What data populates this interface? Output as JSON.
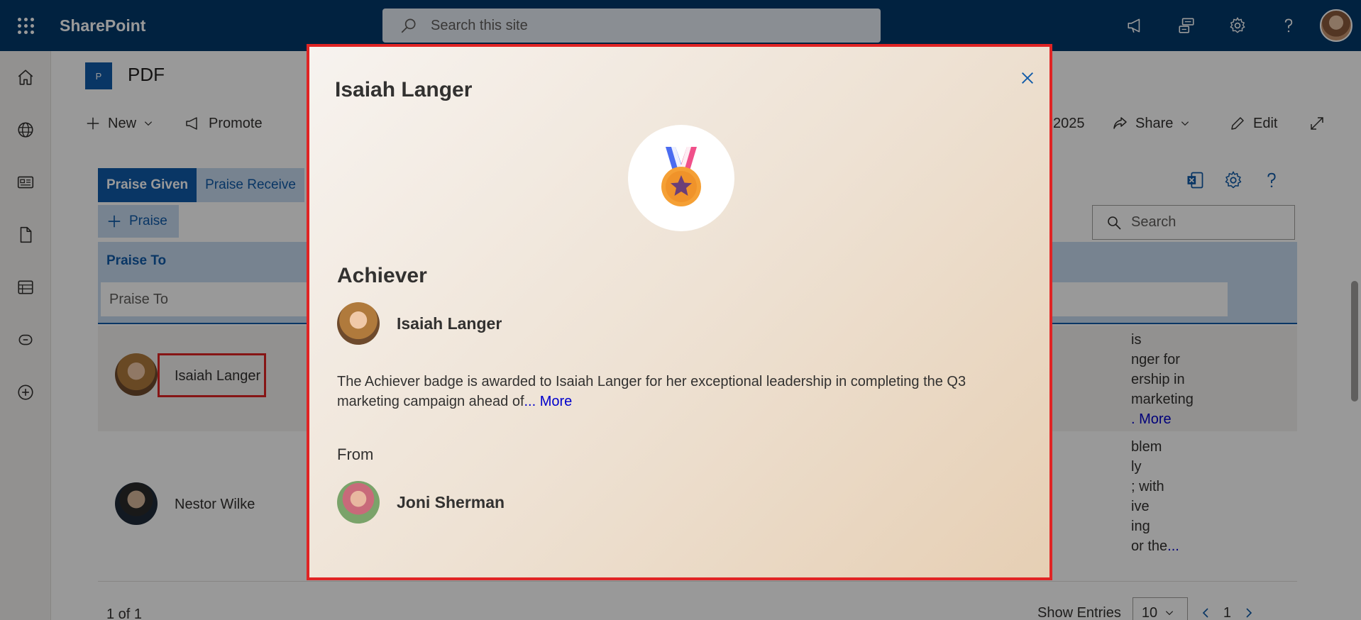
{
  "suitebar": {
    "app_name": "SharePoint",
    "search_placeholder": "Search this site"
  },
  "site": {
    "logo_letter": "P",
    "title": "PDF"
  },
  "commandbar": {
    "new_label": "New",
    "promote_label": "Promote",
    "date_fragment": "2025",
    "share_label": "Share",
    "edit_label": "Edit"
  },
  "webpart": {
    "tabs": [
      {
        "label": "Praise Given",
        "active": true
      },
      {
        "label": "Praise Receive",
        "active": false
      }
    ],
    "add_label": "Praise",
    "search_placeholder": "Search",
    "column_header": "Praise To",
    "column_filter_placeholder": "Praise To",
    "rows": [
      {
        "name": "Isaiah Langer",
        "text_lines": [
          "is",
          "nger for",
          "ership in",
          "marketing"
        ],
        "more": ". More"
      },
      {
        "name": "Nestor Wilke",
        "text_lines": [
          "blem",
          "ly",
          "; with",
          "ive",
          "ing",
          "or the"
        ],
        "more": "..."
      }
    ],
    "pager": {
      "summary": "1 of 1",
      "show_entries_label": "Show Entries",
      "entries_value": "10",
      "page": "1"
    }
  },
  "dialog": {
    "title": "Isaiah Langer",
    "badge_name": "Achiever",
    "recipient_name": "Isaiah Langer",
    "description": "The Achiever badge is awarded to Isaiah Langer for her exceptional leadership in completing the Q3 marketing campaign ahead of",
    "more_label": "... More",
    "from_label": "From",
    "sender_name": "Joni Sherman"
  },
  "colors": {
    "suitebar": "#03396c",
    "accent": "#0f5aa8",
    "highlight_border": "#e02424",
    "link": "#0000cc"
  }
}
